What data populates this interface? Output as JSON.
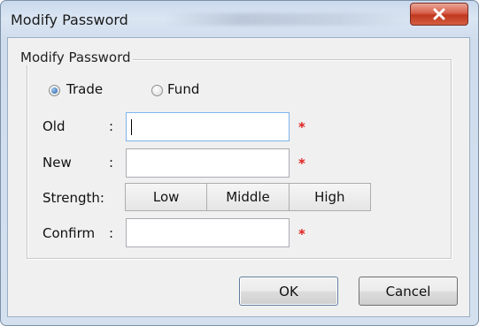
{
  "window": {
    "title": "Modify Password",
    "close_icon": "close-icon"
  },
  "group": {
    "legend": "Modify Password"
  },
  "account_type": {
    "options": [
      {
        "label": "Trade",
        "checked": true
      },
      {
        "label": "Fund",
        "checked": false
      }
    ]
  },
  "fields": {
    "old": {
      "label": "Old",
      "colon": ":",
      "value": "",
      "required_mark": "*"
    },
    "new": {
      "label": "New",
      "colon": ":",
      "value": "",
      "required_mark": "*"
    },
    "strength": {
      "label": "Strength:",
      "levels": [
        "Low",
        "Middle",
        "High"
      ]
    },
    "confirm": {
      "label": "Confirm",
      "colon": ":",
      "value": "",
      "required_mark": "*"
    }
  },
  "buttons": {
    "ok": "OK",
    "cancel": "Cancel"
  },
  "colors": {
    "required": "#e02020",
    "close_button": "#c1381f",
    "focus_border": "#7eb4ea"
  }
}
